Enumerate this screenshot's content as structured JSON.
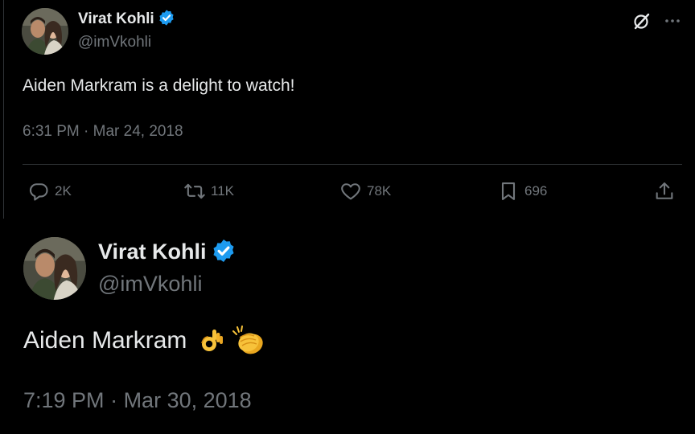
{
  "tweet1": {
    "author_name": "Virat Kohli",
    "author_handle": "@imVkohli",
    "text": "Aiden Markram is a delight to watch!",
    "time": "6:31 PM",
    "separator": " · ",
    "date": "Mar 24, 2018",
    "reply_count": "2K",
    "retweet_count": "11K",
    "like_count": "78K",
    "bookmark_count": "696"
  },
  "tweet2": {
    "author_name": "Virat Kohli",
    "author_handle": "@imVkohli",
    "text": "Aiden Markram",
    "emojis": [
      "ok-hand-icon",
      "clapping-hands-icon"
    ],
    "time": "7:19 PM",
    "separator": " · ",
    "date": "Mar 30, 2018"
  },
  "icons": {
    "verified": "verified-badge-icon",
    "grok": "grok-icon",
    "more": "more-icon",
    "reply": "reply-icon",
    "retweet": "retweet-icon",
    "like": "heart-icon",
    "bookmark": "bookmark-icon",
    "share": "share-icon"
  },
  "colors": {
    "background": "#000000",
    "text_primary": "#e7e9ea",
    "text_secondary": "#71767b",
    "verified_blue": "#1d9bf0",
    "divider": "#2f3336"
  }
}
